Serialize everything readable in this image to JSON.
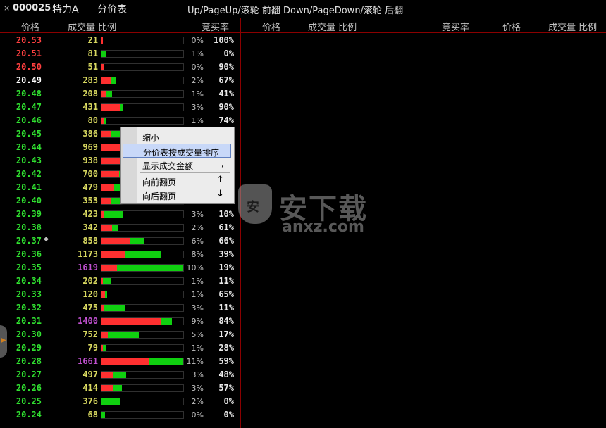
{
  "title": {
    "close": "×",
    "code": "000025",
    "name": "特力A",
    "view": "分价表",
    "hint": "Up/PageUp/滚轮 前翻 Down/PageDown/滚轮 后翻"
  },
  "columns": {
    "price": "价格",
    "volume_ratio": "成交量 比例",
    "bid_rate": "竞买率"
  },
  "colors": {
    "up": "#ff4040",
    "down": "#30e030",
    "flat": "#ffffff",
    "volume": "#d8d860",
    "volume_big": "#c050d0"
  },
  "rows": [
    {
      "price": "20.53",
      "vol": "21",
      "pct": "0%",
      "ratio": "100%",
      "dir": "up",
      "red": 1.0,
      "green": 0.0,
      "share": 0.01
    },
    {
      "price": "20.51",
      "vol": "81",
      "pct": "1%",
      "ratio": "0%",
      "dir": "up",
      "red": 0.0,
      "green": 1.0,
      "share": 0.05
    },
    {
      "price": "20.50",
      "vol": "51",
      "pct": "0%",
      "ratio": "90%",
      "dir": "up",
      "red": 0.9,
      "green": 0.1,
      "share": 0.03
    },
    {
      "price": "20.49",
      "vol": "283",
      "pct": "2%",
      "ratio": "67%",
      "dir": "flat",
      "red": 0.67,
      "green": 0.33,
      "share": 0.17
    },
    {
      "price": "20.48",
      "vol": "208",
      "pct": "1%",
      "ratio": "41%",
      "dir": "down",
      "red": 0.41,
      "green": 0.59,
      "share": 0.13
    },
    {
      "price": "20.47",
      "vol": "431",
      "pct": "3%",
      "ratio": "90%",
      "dir": "down",
      "red": 0.9,
      "green": 0.1,
      "share": 0.26
    },
    {
      "price": "20.46",
      "vol": "80",
      "pct": "1%",
      "ratio": "74%",
      "dir": "down",
      "red": 0.74,
      "green": 0.26,
      "share": 0.05
    },
    {
      "price": "20.45",
      "vol": "386",
      "pct": "",
      "ratio": "",
      "dir": "down",
      "red": 0.5,
      "green": 0.5,
      "share": 0.24
    },
    {
      "price": "20.44",
      "vol": "969",
      "pct": "",
      "ratio": "",
      "dir": "down",
      "red": 0.5,
      "green": 0.5,
      "share": 0.6
    },
    {
      "price": "20.43",
      "vol": "938",
      "pct": "",
      "ratio": "",
      "dir": "down",
      "red": 0.5,
      "green": 0.5,
      "share": 0.58
    },
    {
      "price": "20.42",
      "vol": "700",
      "pct": "",
      "ratio": "",
      "dir": "down",
      "red": 0.5,
      "green": 0.5,
      "share": 0.43
    },
    {
      "price": "20.41",
      "vol": "479",
      "pct": "",
      "ratio": "",
      "dir": "down",
      "red": 0.5,
      "green": 0.5,
      "share": 0.3
    },
    {
      "price": "20.40",
      "vol": "353",
      "pct": "",
      "ratio": "",
      "dir": "down",
      "red": 0.5,
      "green": 0.5,
      "share": 0.22
    },
    {
      "price": "20.39",
      "vol": "423",
      "pct": "3%",
      "ratio": "10%",
      "dir": "down",
      "red": 0.1,
      "green": 0.9,
      "share": 0.26
    },
    {
      "price": "20.38",
      "vol": "342",
      "pct": "2%",
      "ratio": "61%",
      "dir": "down",
      "red": 0.61,
      "green": 0.39,
      "share": 0.21
    },
    {
      "price": "20.37",
      "vol": "858",
      "pct": "6%",
      "ratio": "66%",
      "dir": "down",
      "red": 0.66,
      "green": 0.34,
      "share": 0.53,
      "mark": "◆"
    },
    {
      "price": "20.36",
      "vol": "1173",
      "pct": "8%",
      "ratio": "39%",
      "dir": "down",
      "red": 0.39,
      "green": 0.61,
      "share": 0.72
    },
    {
      "price": "20.35",
      "vol": "1619",
      "pct": "10%",
      "ratio": "19%",
      "dir": "down",
      "red": 0.19,
      "green": 0.81,
      "share": 0.99,
      "big": true
    },
    {
      "price": "20.34",
      "vol": "202",
      "pct": "1%",
      "ratio": "11%",
      "dir": "down",
      "red": 0.11,
      "green": 0.89,
      "share": 0.12
    },
    {
      "price": "20.33",
      "vol": "120",
      "pct": "1%",
      "ratio": "65%",
      "dir": "down",
      "red": 0.65,
      "green": 0.35,
      "share": 0.07
    },
    {
      "price": "20.32",
      "vol": "475",
      "pct": "3%",
      "ratio": "11%",
      "dir": "down",
      "red": 0.11,
      "green": 0.89,
      "share": 0.29
    },
    {
      "price": "20.31",
      "vol": "1400",
      "pct": "9%",
      "ratio": "84%",
      "dir": "down",
      "red": 0.84,
      "green": 0.16,
      "share": 0.86,
      "big": true
    },
    {
      "price": "20.30",
      "vol": "752",
      "pct": "5%",
      "ratio": "17%",
      "dir": "down",
      "red": 0.17,
      "green": 0.83,
      "share": 0.46
    },
    {
      "price": "20.29",
      "vol": "79",
      "pct": "1%",
      "ratio": "28%",
      "dir": "down",
      "red": 0.28,
      "green": 0.72,
      "share": 0.05
    },
    {
      "price": "20.28",
      "vol": "1661",
      "pct": "11%",
      "ratio": "59%",
      "dir": "down",
      "red": 0.59,
      "green": 0.41,
      "share": 1.0,
      "big": true
    },
    {
      "price": "20.27",
      "vol": "497",
      "pct": "3%",
      "ratio": "48%",
      "dir": "down",
      "red": 0.48,
      "green": 0.52,
      "share": 0.3
    },
    {
      "price": "20.26",
      "vol": "414",
      "pct": "3%",
      "ratio": "57%",
      "dir": "down",
      "red": 0.57,
      "green": 0.43,
      "share": 0.25
    },
    {
      "price": "20.25",
      "vol": "376",
      "pct": "2%",
      "ratio": "0%",
      "dir": "down",
      "red": 0.0,
      "green": 1.0,
      "share": 0.23
    },
    {
      "price": "20.24",
      "vol": "68",
      "pct": "0%",
      "ratio": "0%",
      "dir": "down",
      "red": 0.0,
      "green": 1.0,
      "share": 0.04
    }
  ],
  "menu": {
    "items": [
      {
        "label": "缩小",
        "key": ""
      },
      {
        "label": "分价表按成交量排序",
        "key": "",
        "selected": true
      },
      {
        "label": "显示成交金额",
        "key": ","
      },
      {
        "label": "向前翻页",
        "key": "↑"
      },
      {
        "label": "向后翻页",
        "key": "↓"
      }
    ]
  },
  "watermark": {
    "icon_text": "安",
    "title": "安下载",
    "sub": "anxz.com"
  },
  "side_tab": {
    "icon": "▶"
  }
}
